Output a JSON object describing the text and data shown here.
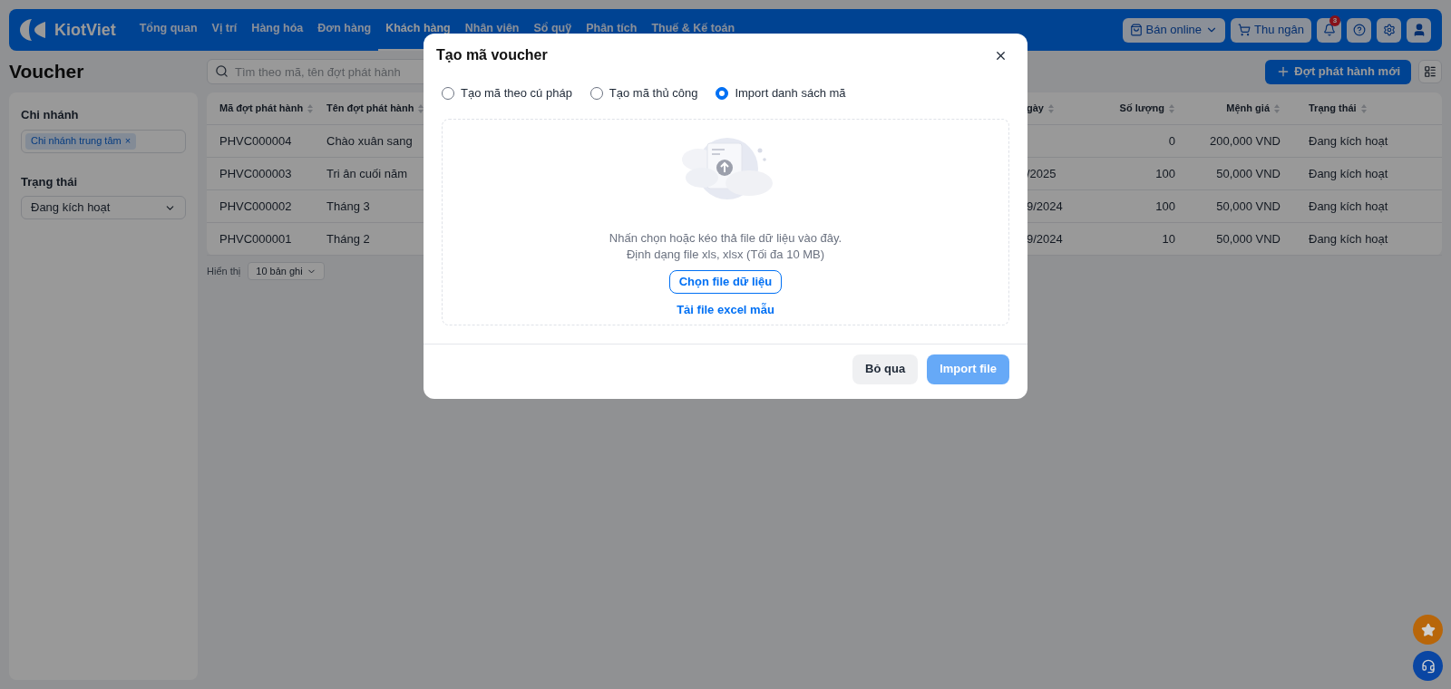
{
  "header": {
    "logo": "KiotViet",
    "nav": [
      {
        "label": "Tổng quan",
        "selected": false
      },
      {
        "label": "Vị trí",
        "selected": false
      },
      {
        "label": "Hàng hóa",
        "selected": false
      },
      {
        "label": "Đơn hàng",
        "selected": false
      },
      {
        "label": "Khách hàng",
        "selected": true
      },
      {
        "label": "Nhân viên",
        "selected": false
      },
      {
        "label": "Sổ quỹ",
        "selected": false
      },
      {
        "label": "Phân tích",
        "selected": false
      },
      {
        "label": "Thuế & Kế toán",
        "selected": false
      }
    ],
    "online_button": "Bán online",
    "cashier_button": "Thu ngân",
    "notification_count": "3"
  },
  "page": {
    "title": "Voucher",
    "search": {
      "placeholder": "Tìm theo mã, tên đợt phát hành"
    },
    "new_button": "Đợt phát hành mới"
  },
  "filters": {
    "branch": {
      "label": "Chi nhánh",
      "chips": [
        "Chi nhánh trung tâm"
      ],
      "remove_glyph": "×"
    },
    "status": {
      "label": "Trạng thái",
      "value": "Đang kích hoạt"
    }
  },
  "table": {
    "columns": [
      "Mã đợt phát hành",
      "Tên đợt phát hành",
      "gày",
      "Số lượng",
      "Mệnh giá",
      "Trạng thái"
    ],
    "rows": [
      [
        "PHVC000004",
        "Chào xuân sang",
        "",
        "0",
        "200,000 VND",
        "Đang kích hoạt"
      ],
      [
        "PHVC000003",
        "Tri ân cuối năm",
        "/2025",
        "100",
        "50,000 VND",
        "Đang kích hoạt"
      ],
      [
        "PHVC000002",
        "Tháng 3",
        "9/2024",
        "100",
        "50,000 VND",
        "Đang kích hoạt"
      ],
      [
        "PHVC000001",
        "Tháng 2",
        "9/2024",
        "10",
        "50,000 VND",
        "Đang kích hoạt"
      ]
    ],
    "page_size_label": "Hiển thị",
    "page_size": "10 bản ghi"
  },
  "dialog": {
    "title": "Tạo mã voucher",
    "options": [
      {
        "label": "Tạo mã theo cú pháp",
        "selected": false
      },
      {
        "label": "Tạo mã thủ công",
        "selected": false
      },
      {
        "label": "Import danh sách mã",
        "selected": true
      }
    ],
    "drop_hint": "Nhấn chọn hoặc kéo thả file dữ liệu vào đây.",
    "format_hint": "Định dạng file xls, xlsx (Tối đa 10 MB)",
    "choose_button": "Chọn file dữ liệu",
    "template_link": "Tải file excel mẫu",
    "cancel_button": "Bỏ qua",
    "import_button": {
      "label": "Import file",
      "disabled": true
    }
  }
}
